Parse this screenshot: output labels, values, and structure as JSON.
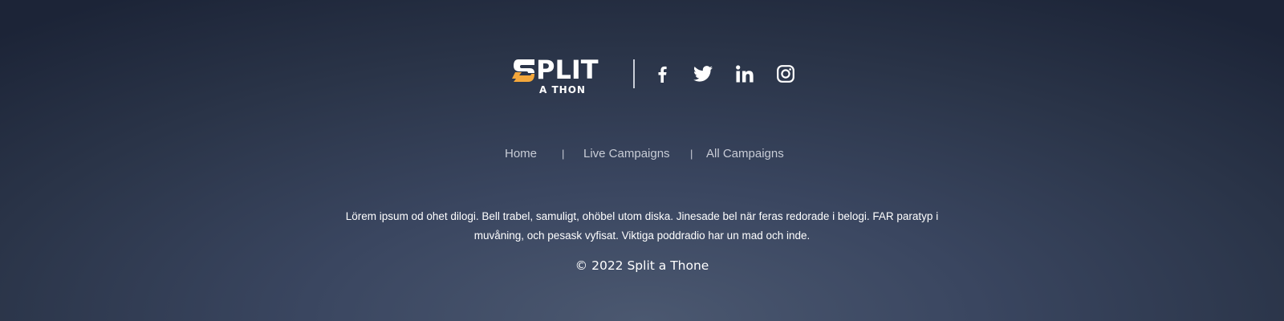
{
  "brand": {
    "logo_main": "PLIT",
    "logo_sub": "A THON",
    "logo_text": "SPLIT A THON",
    "accent_color": "#f4a73b"
  },
  "social": [
    {
      "name": "facebook",
      "icon": "facebook-icon"
    },
    {
      "name": "twitter",
      "icon": "twitter-icon"
    },
    {
      "name": "linkedin",
      "icon": "linkedin-icon"
    },
    {
      "name": "instagram",
      "icon": "instagram-icon"
    }
  ],
  "nav": {
    "home": "Home",
    "separator": "|",
    "live_campaigns": "Live Campaigns",
    "all_campaigns": "All Campaigns"
  },
  "description": "Lörem ipsum od ohet dilogi. Bell trabel, samuligt, ohöbel utom diska. Jinesade bel när feras redorade i belogi. FAR paratyp i muvåning, och pesask vyfisat. Viktiga poddradio har un mad och inde.",
  "copyright": "© 2022 Split a Thone",
  "colors": {
    "background_top": "#1c2437",
    "background_bottom": "#4b5870",
    "nav_text": "#c8ccd6",
    "text": "#ffffff"
  }
}
